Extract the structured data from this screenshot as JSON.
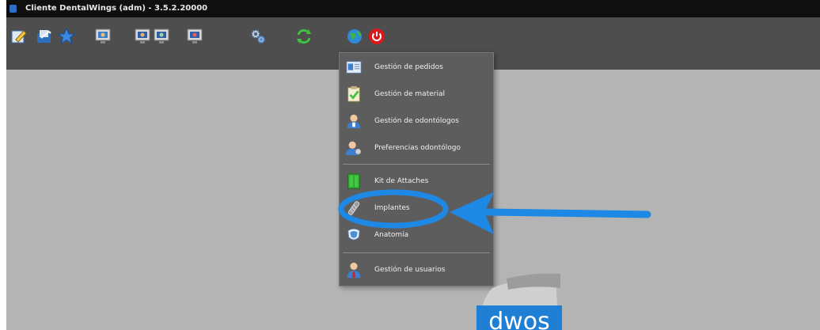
{
  "window": {
    "title": "Cliente DentalWings (adm) - 3.5.2.20000"
  },
  "toolbar": {
    "buttons": [
      {
        "icon": "edit-icon"
      },
      {
        "icon": "open-folder-icon"
      },
      {
        "icon": "star-icon"
      },
      {
        "icon": "scan-monitor-icon"
      },
      {
        "icon": "monitor-icon"
      },
      {
        "icon": "monitor-icon"
      },
      {
        "icon": "monitor-icon"
      },
      {
        "icon": "gears-icon"
      },
      {
        "icon": "sync-icon"
      },
      {
        "icon": "globe-icon"
      },
      {
        "icon": "power-icon"
      }
    ]
  },
  "menu": {
    "items": [
      {
        "label": "Gestión de pedidos",
        "icon": "orders-icon"
      },
      {
        "label": "Gestión de material",
        "icon": "material-icon"
      },
      {
        "label": "Gestión de odontólogos",
        "icon": "dentist-icon"
      },
      {
        "label": "Preferencias odontólogo",
        "icon": "dentist-preferences-icon"
      },
      {
        "label": "Kit de Attaches",
        "icon": "attachments-kit-icon"
      },
      {
        "label": "Implantes",
        "icon": "implant-icon"
      },
      {
        "label": "Anatomía",
        "icon": "anatomy-icon"
      },
      {
        "label": "Gestión de usuarios",
        "icon": "users-icon"
      }
    ]
  },
  "logo": {
    "text": "dwos"
  },
  "annotation": {
    "color": "#1e88e5"
  }
}
